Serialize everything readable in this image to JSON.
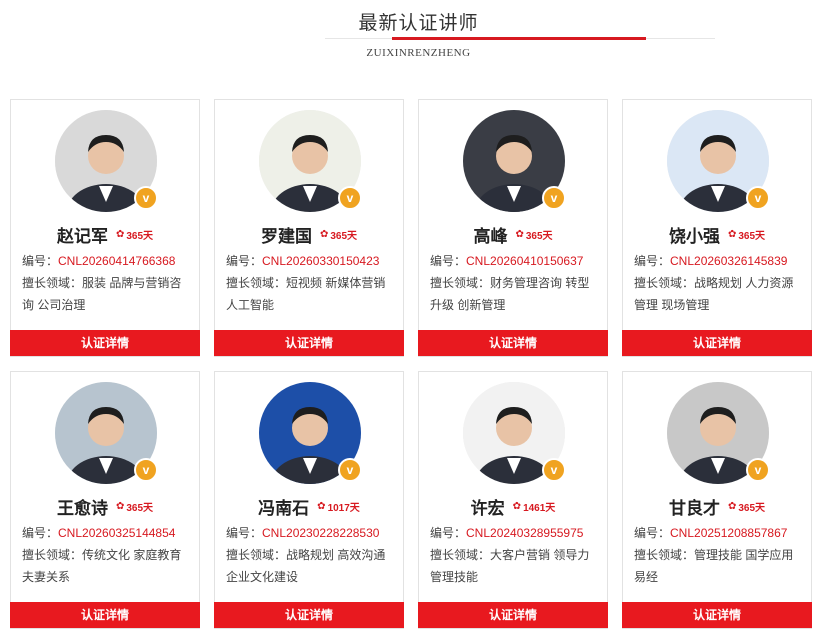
{
  "header": {
    "title": "最新认证讲师",
    "subtitle": "ZUIXINRENZHENG"
  },
  "labels": {
    "id_prefix": "编号：",
    "specialty_prefix": "擅长领域：",
    "detail_button": "认证详情"
  },
  "colors": {
    "accent": "#d71920",
    "button": "#e8191f",
    "badge": "#f0a320"
  },
  "instructors": [
    {
      "name": "赵记军",
      "days": "365天",
      "id": "CNL20260414766368",
      "specialty": "服装 品牌与营销咨询 公司治理",
      "avatar_bg": "#d9d9d9"
    },
    {
      "name": "罗建国",
      "days": "365天",
      "id": "CNL20260330150423",
      "specialty": "短视频 新媒体营销 人工智能",
      "avatar_bg": "#eef0e8"
    },
    {
      "name": "高峰",
      "days": "365天",
      "id": "CNL20260410150637",
      "specialty": "财务管理咨询 转型升级 创新管理",
      "avatar_bg": "#3a3d45"
    },
    {
      "name": "饶小强",
      "days": "365天",
      "id": "CNL20260326145839",
      "specialty": "战略规划 人力资源管理 现场管理",
      "avatar_bg": "#dbe7f5"
    },
    {
      "name": "王愈诗",
      "days": "365天",
      "id": "CNL20260325144854",
      "specialty": "传统文化 家庭教育 夫妻关系",
      "avatar_bg": "#b7c4cf"
    },
    {
      "name": "冯南石",
      "days": "1017天",
      "id": "CNL20230228228530",
      "specialty": "战略规划 高效沟通 企业文化建设",
      "avatar_bg": "#1d4fa8"
    },
    {
      "name": "许宏",
      "days": "1461天",
      "id": "CNL20240328955975",
      "specialty": "大客户营销 领导力 管理技能",
      "avatar_bg": "#f2f2f2"
    },
    {
      "name": "甘良才",
      "days": "365天",
      "id": "CNL20251208857867",
      "specialty": "管理技能 国学应用 易经",
      "avatar_bg": "#c8c8c8"
    }
  ]
}
